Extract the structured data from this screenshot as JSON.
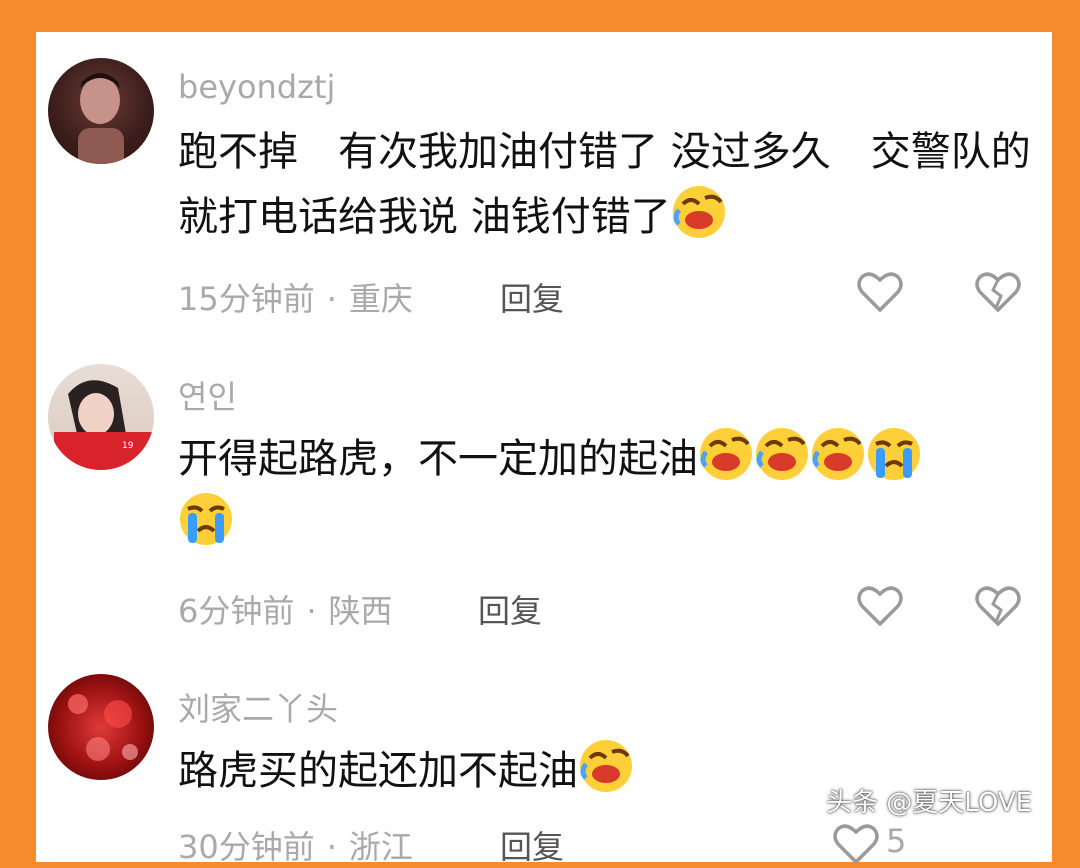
{
  "comments": [
    {
      "username": "beyondztj",
      "text": "跑不掉　有次我加油付错了 没过多久　交警队的就打电话给我说 油钱付错了",
      "time": "15分钟前",
      "location": "重庆",
      "reply_label": "回复",
      "emojis": [
        "laughing-crying-emoji"
      ]
    },
    {
      "username": "연인",
      "text": "开得起路虎，不一定加的起油",
      "time": "6分钟前",
      "location": "陕西",
      "reply_label": "回复",
      "emojis": [
        "laughing-crying-emoji",
        "laughing-crying-emoji",
        "laughing-crying-emoji",
        "loudly-crying-emoji",
        "loudly-crying-emoji"
      ]
    },
    {
      "username": "刘家二丫头",
      "text": "路虎买的起还加不起油",
      "time": "30分钟前",
      "location": "浙江",
      "reply_label": "回复",
      "like_count": "5",
      "emojis": [
        "laughing-crying-emoji"
      ]
    }
  ],
  "watermark": "头条 @夏天LOVE",
  "colors": {
    "frame": "#f58a2e",
    "meta": "#a9a9a9",
    "text": "#111111"
  }
}
